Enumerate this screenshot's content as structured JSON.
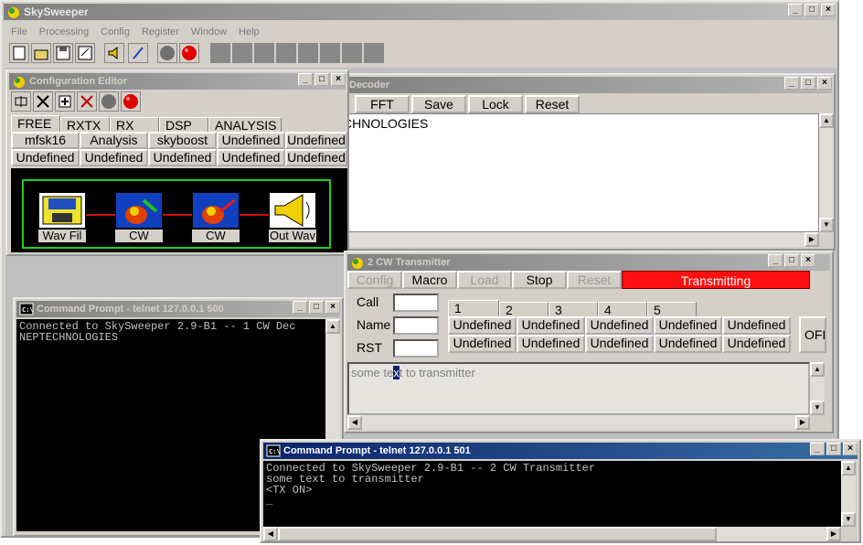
{
  "main": {
    "title": "SkySweeper",
    "menu": [
      "File",
      "Processing",
      "Config",
      "Register",
      "Window",
      "Help"
    ]
  },
  "config_editor": {
    "title": "Configuration Editor",
    "tabs": [
      "FREE",
      "RXTX",
      "RX",
      "DSP",
      "ANALYSIS"
    ],
    "row1": [
      "mfsk16",
      "Analysis",
      "skyboost",
      "Undefined",
      "Undefined"
    ],
    "row2": [
      "Undefined",
      "Undefined",
      "Undefined",
      "Undefined",
      "Undefined"
    ],
    "chain": [
      "Wav Fil",
      "CW",
      "CW",
      "Out Wav"
    ]
  },
  "decoder": {
    "title": "Decoder",
    "buttons": [
      "FFT",
      "Save",
      "Lock",
      "Reset"
    ],
    "text": "CHNOLOGIES"
  },
  "cw_tx": {
    "title": "2 CW Transmitter",
    "buttons": [
      "Config",
      "Macro",
      "Load",
      "Stop",
      "Reset"
    ],
    "status": "Transmitting",
    "labels": [
      "Call",
      "Name",
      "RST"
    ],
    "tabs": [
      "1",
      "2",
      "3",
      "4",
      "5"
    ],
    "row1": [
      "Undefined",
      "Undefined",
      "Undefined",
      "Undefined",
      "Undefined"
    ],
    "row2": [
      "Undefined",
      "Undefined",
      "Undefined",
      "Undefined",
      "Undefined"
    ],
    "side_button": "OFF",
    "text_before": "some te",
    "text_sel": "x",
    "text_after": "t to transmitter"
  },
  "cmd1": {
    "title": "Command Prompt - telnet 127.0.0.1 500",
    "lines": "Connected to SkySweeper 2.9-B1 -- 1 CW Dec\nNEPTECHNOLOGIES"
  },
  "cmd2": {
    "title": "Command Prompt - telnet 127.0.0.1 501",
    "lines": "Connected to SkySweeper 2.9-B1 -- 2 CW Transmitter\nsome text to transmitter\n<TX ON>\n_"
  },
  "colors": {
    "active_title": "#0a246a",
    "transmitting": "#ff1010",
    "chain_border": "#22cc22"
  }
}
